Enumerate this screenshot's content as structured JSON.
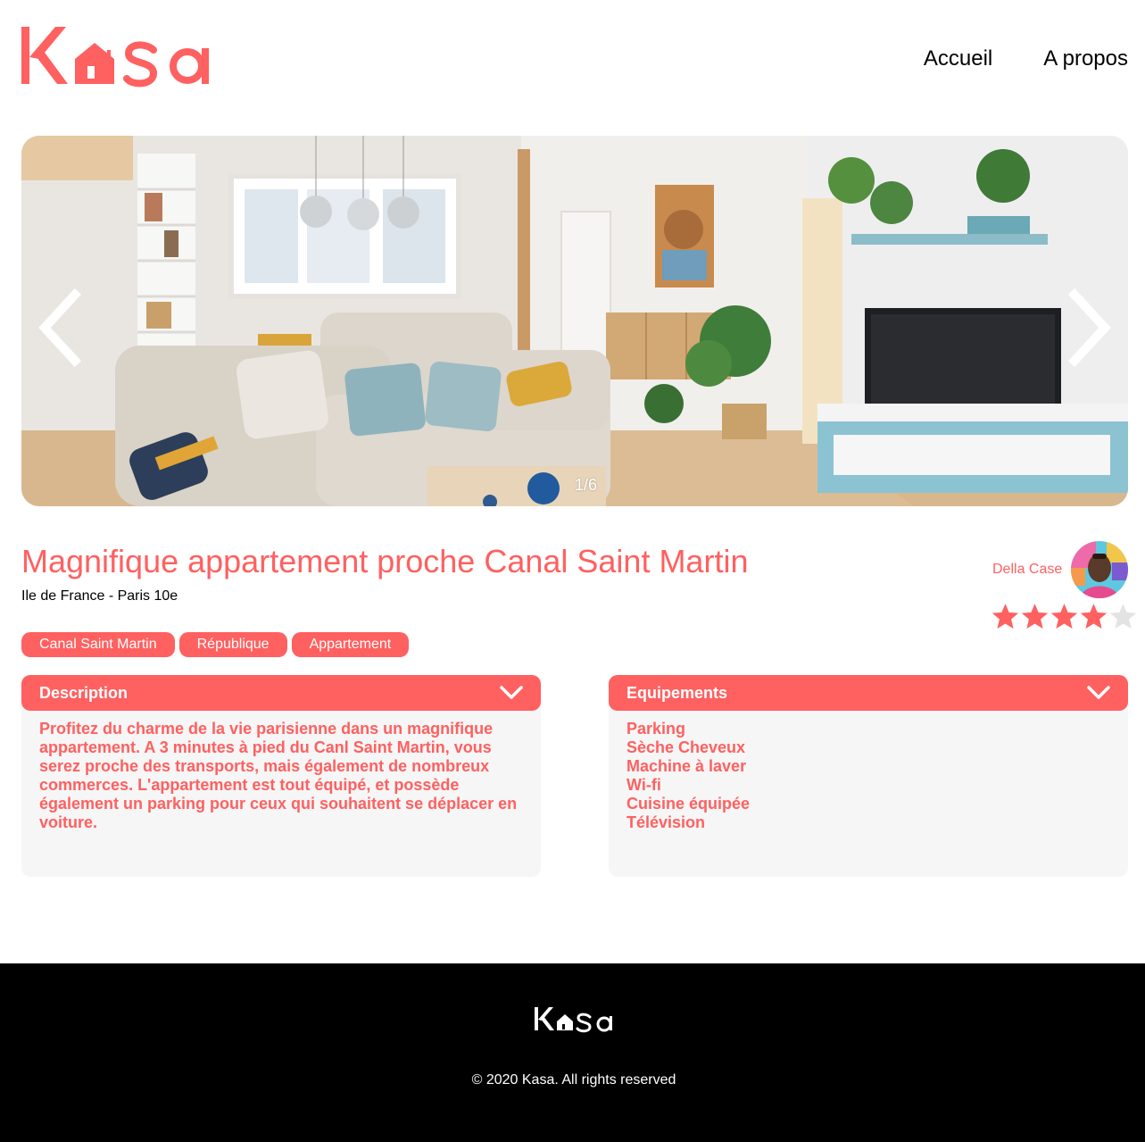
{
  "brand": {
    "name": "Kasa",
    "accent_color": "#ff6060"
  },
  "nav": {
    "items": [
      {
        "label": "Accueil"
      },
      {
        "label": "A propos"
      }
    ]
  },
  "carousel": {
    "counter": "1/6",
    "prev_icon": "chevron-left-icon",
    "next_icon": "chevron-right-icon"
  },
  "listing": {
    "title": "Magnifique appartement proche Canal Saint Martin",
    "location": "Ile de France - Paris 10e",
    "tags": [
      "Canal Saint Martin",
      "République",
      "Appartement"
    ],
    "rating": 4,
    "rating_max": 5
  },
  "host": {
    "name": "Della Case"
  },
  "description": {
    "title": "Description",
    "text": "Profitez du charme de la vie parisienne dans un magnifique appartement. A 3 minutes à pied du Canl Saint Martin, vous serez proche des transports, mais également de nombreux commerces. L'appartement est tout équipé, et possède également un parking pour ceux qui souhaitent se déplacer en voiture."
  },
  "equipements": {
    "title": "Equipements",
    "items": [
      "Parking",
      "Sèche Cheveux",
      "Machine à laver",
      "Wi-fi",
      "Cuisine équipée",
      "Télévision"
    ]
  },
  "footer": {
    "copyright": "© 2020 Kasa. All rights reserved"
  }
}
